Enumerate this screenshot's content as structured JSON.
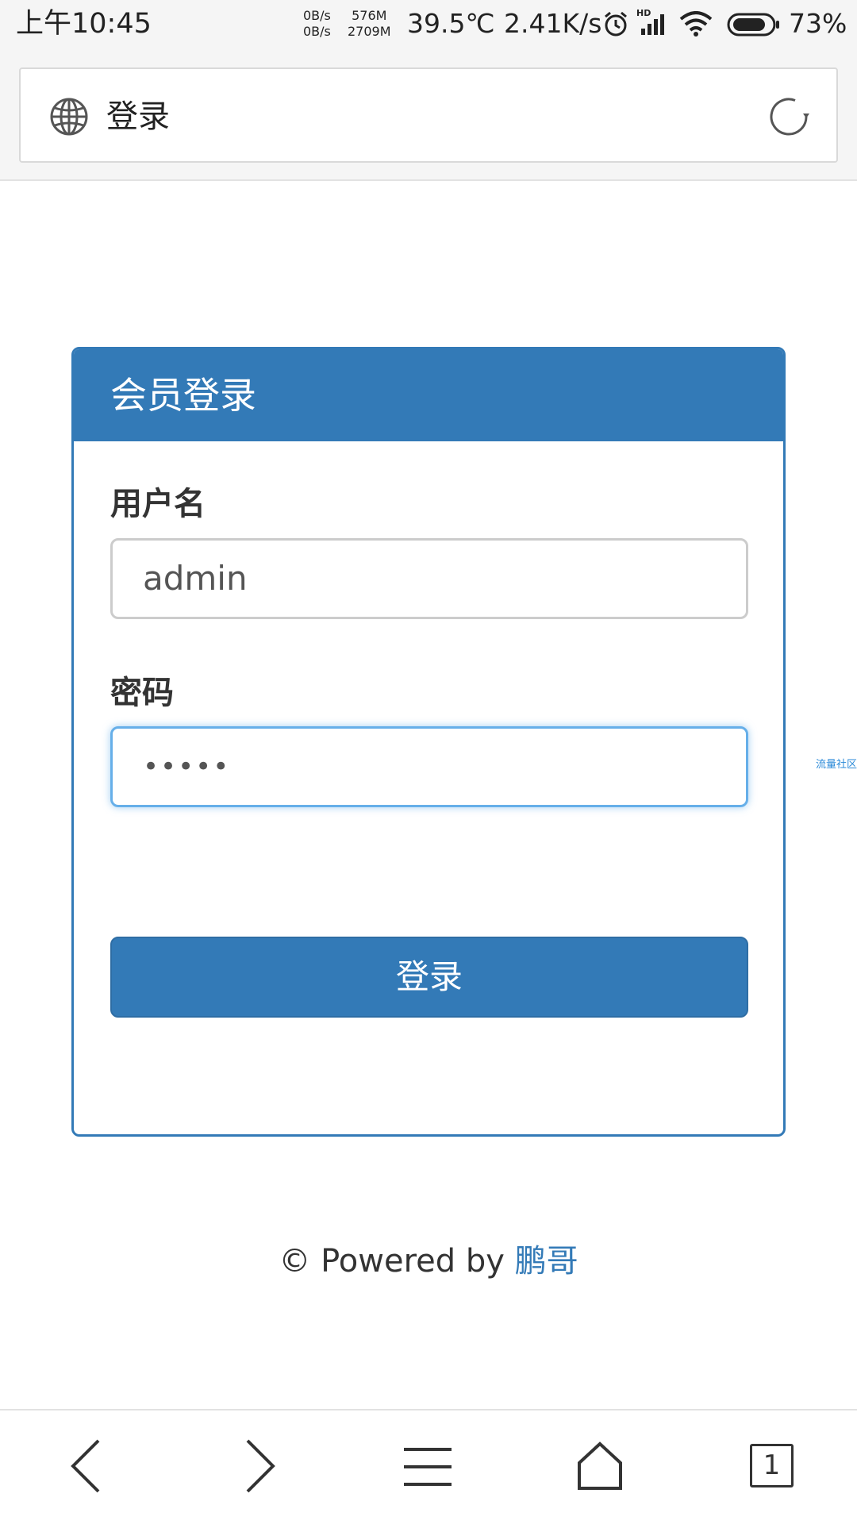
{
  "status_bar": {
    "time": "上午10:45",
    "net_up": "0B/s",
    "net_down": "0B/s",
    "mem_used": "576M",
    "mem_total": "2709M",
    "temperature": "39.5℃",
    "speed": "2.41K/s",
    "network_label": "HD",
    "battery": "73%"
  },
  "browser": {
    "page_title": "登录",
    "tab_count": "1"
  },
  "login": {
    "heading": "会员登录",
    "username_label": "用户名",
    "username_value": "admin",
    "password_label": "密码",
    "password_value": "•••••",
    "submit_label": "登录"
  },
  "side_watermark": "流量社区",
  "footer": {
    "text": "© Powered by ",
    "author": "鹏哥"
  }
}
